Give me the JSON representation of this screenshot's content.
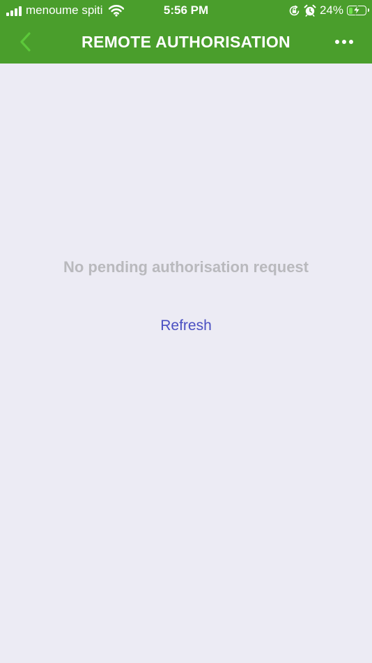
{
  "status_bar": {
    "carrier": "menoume spiti",
    "time": "5:56 PM",
    "battery_percent": "24%",
    "battery_level": 0.24,
    "icons": [
      "signal-icon",
      "wifi-icon",
      "orientation-lock-icon",
      "alarm-icon",
      "battery-icon",
      "charging-bolt-icon"
    ]
  },
  "header": {
    "title": "REMOTE AUTHORISATION",
    "back_icon": "chevron-left-icon",
    "more_icon": "more-horizontal-icon"
  },
  "main": {
    "empty_message": "No pending authorisation request",
    "refresh_label": "Refresh"
  },
  "colors": {
    "brand": "#4a9e2c",
    "back_chevron": "#5cc83a",
    "background": "#ecebf4",
    "empty_text": "#b9b9bd",
    "link": "#4a4fc2",
    "battery_fill": "#6fe34a"
  }
}
